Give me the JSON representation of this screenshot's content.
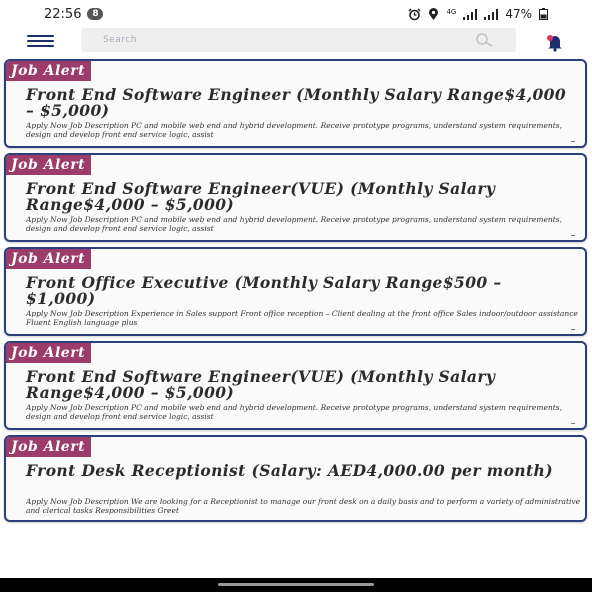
{
  "status_bar": {
    "time": "22:56",
    "notification_count": "8",
    "network_label": "4G",
    "battery": "47%"
  },
  "search": {
    "placeholder": "Search"
  },
  "jobs": [
    {
      "badge": "Job Alert",
      "title": "Front End Software Engineer (Monthly Salary Range$4,000 – $5,000)",
      "description": "Apply Now Job Description PC and mobile web end and hybrid development. Receive prototype programs, understand system requirements, design and develop front end service logic, assist"
    },
    {
      "badge": "Job Alert",
      "title": "Front End Software Engineer(VUE) (Monthly Salary Range$4,000 – $5,000)",
      "description": "Apply Now Job Description PC and mobile web end and hybrid development. Receive prototype programs, understand system requirements, design and develop front end service logic, assist"
    },
    {
      "badge": "Job Alert",
      "title": "Front Office Executive (Monthly Salary Range$500 – $1,000)",
      "description": "Apply Now Job Description Experience in Sales support Front office reception – Client dealing at the front office Sales indoor/outdoor assistance Fluent English language plus"
    },
    {
      "badge": "Job Alert",
      "title": "Front End Software Engineer(VUE) (Monthly Salary Range$4,000 – $5,000)",
      "description": "Apply Now Job Description PC and mobile web end and hybrid development. Receive prototype programs, understand system requirements, design and develop front end service logic, assist"
    },
    {
      "badge": "Job Alert",
      "title": "Front Desk Receptionist (Salary: AED4,000.00 per month)",
      "description": "Apply Now Job Description We are looking for a Receptionist to manage our front desk on a daily basis and to perform a variety of administrative and clerical tasks Responsibilities Greet"
    }
  ],
  "colors": {
    "badge_bg": "#9b3c6a",
    "card_border": "#2c3e7c",
    "menu_icon": "#1b2f6e",
    "bell_icon": "#1b2f6e",
    "bell_badge": "#d9365e"
  }
}
